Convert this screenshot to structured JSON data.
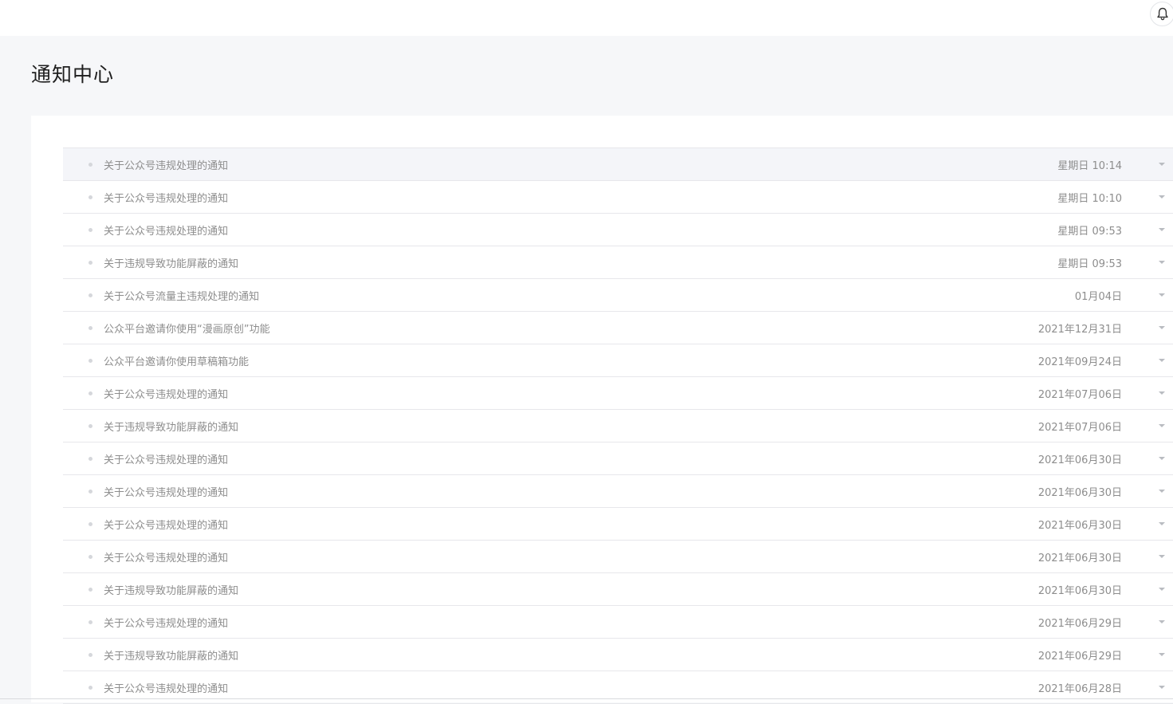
{
  "header": {
    "icons": {
      "bell": "bell-icon"
    }
  },
  "page": {
    "title": "通知中心"
  },
  "notifications": [
    {
      "title": "关于公众号违规处理的通知",
      "time": "星期日 10:14"
    },
    {
      "title": "关于公众号违规处理的通知",
      "time": "星期日 10:10"
    },
    {
      "title": "关于公众号违规处理的通知",
      "time": "星期日 09:53"
    },
    {
      "title": "关于违规导致功能屏蔽的通知",
      "time": "星期日 09:53"
    },
    {
      "title": "关于公众号流量主违规处理的通知",
      "time": "01月04日"
    },
    {
      "title": "公众平台邀请你使用“漫画原创”功能",
      "time": "2021年12月31日"
    },
    {
      "title": "公众平台邀请你使用草稿箱功能",
      "time": "2021年09月24日"
    },
    {
      "title": "关于公众号违规处理的通知",
      "time": "2021年07月06日"
    },
    {
      "title": "关于违规导致功能屏蔽的通知",
      "time": "2021年07月06日"
    },
    {
      "title": "关于公众号违规处理的通知",
      "time": "2021年06月30日"
    },
    {
      "title": "关于公众号违规处理的通知",
      "time": "2021年06月30日"
    },
    {
      "title": "关于公众号违规处理的通知",
      "time": "2021年06月30日"
    },
    {
      "title": "关于公众号违规处理的通知",
      "time": "2021年06月30日"
    },
    {
      "title": "关于违规导致功能屏蔽的通知",
      "time": "2021年06月30日"
    },
    {
      "title": "关于公众号违规处理的通知",
      "time": "2021年06月29日"
    },
    {
      "title": "关于违规导致功能屏蔽的通知",
      "time": "2021年06月29日"
    },
    {
      "title": "关于公众号违规处理的通知",
      "time": "2021年06月28日"
    }
  ]
}
